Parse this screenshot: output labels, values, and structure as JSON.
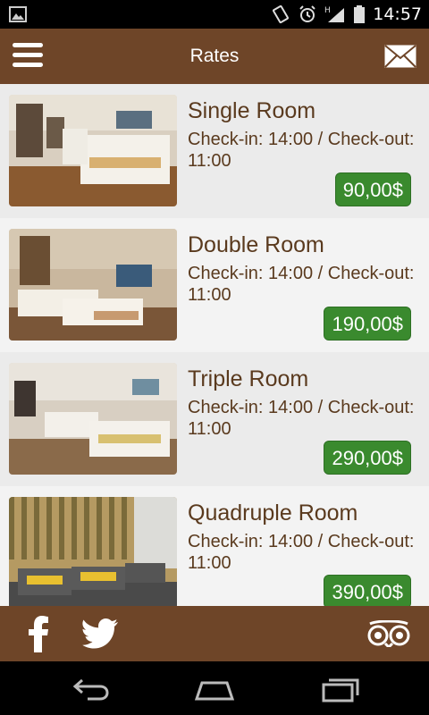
{
  "status_bar": {
    "time": "14:57",
    "network_label": "H"
  },
  "app_bar": {
    "title": "Rates",
    "menu_icon": "menu-icon",
    "mail_icon": "mail-icon"
  },
  "rooms": [
    {
      "name": "Single Room",
      "hours": "Check-in: 14:00 / Check-out: 11:00",
      "price": "90,00$"
    },
    {
      "name": "Double Room",
      "hours": "Check-in: 14:00 / Check-out: 11:00",
      "price": "190,00$"
    },
    {
      "name": "Triple Room",
      "hours": "Check-in: 14:00 / Check-out: 11:00",
      "price": "290,00$"
    },
    {
      "name": "Quadruple Room",
      "hours": "Check-in: 14:00 / Check-out: 11:00",
      "price": "390,00$"
    }
  ],
  "footer": {
    "icons": [
      "facebook-icon",
      "twitter-icon",
      "tripadvisor-icon"
    ]
  },
  "nav_bar": {
    "icons": [
      "back-icon",
      "home-icon",
      "recent-apps-icon"
    ]
  },
  "colors": {
    "brand_brown": "#6e4528",
    "price_green": "#3a8a2e",
    "text_brown": "#5a3a1e"
  }
}
